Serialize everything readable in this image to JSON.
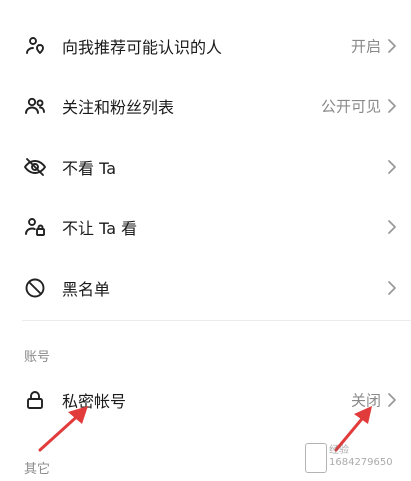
{
  "rows": [
    {
      "label": "向我推荐可能认识的人",
      "value": "开启",
      "icon": "person-location-icon"
    },
    {
      "label": "关注和粉丝列表",
      "value": "公开可见",
      "icon": "people-icon"
    },
    {
      "label": "不看 Ta",
      "value": "",
      "icon": "eye-slash-icon"
    },
    {
      "label": "不让 Ta 看",
      "value": "",
      "icon": "person-lock-icon"
    },
    {
      "label": "黑名单",
      "value": "",
      "icon": "block-icon"
    }
  ],
  "account_section": {
    "header": "账号",
    "rows": [
      {
        "label": "私密帐号",
        "value": "关闭",
        "icon": "lock-icon"
      }
    ]
  },
  "other_section": {
    "header": "其它"
  },
  "annotation": {
    "arrow_color": "#e23b3b"
  },
  "watermark": {
    "text": "经验\n1684279650"
  }
}
